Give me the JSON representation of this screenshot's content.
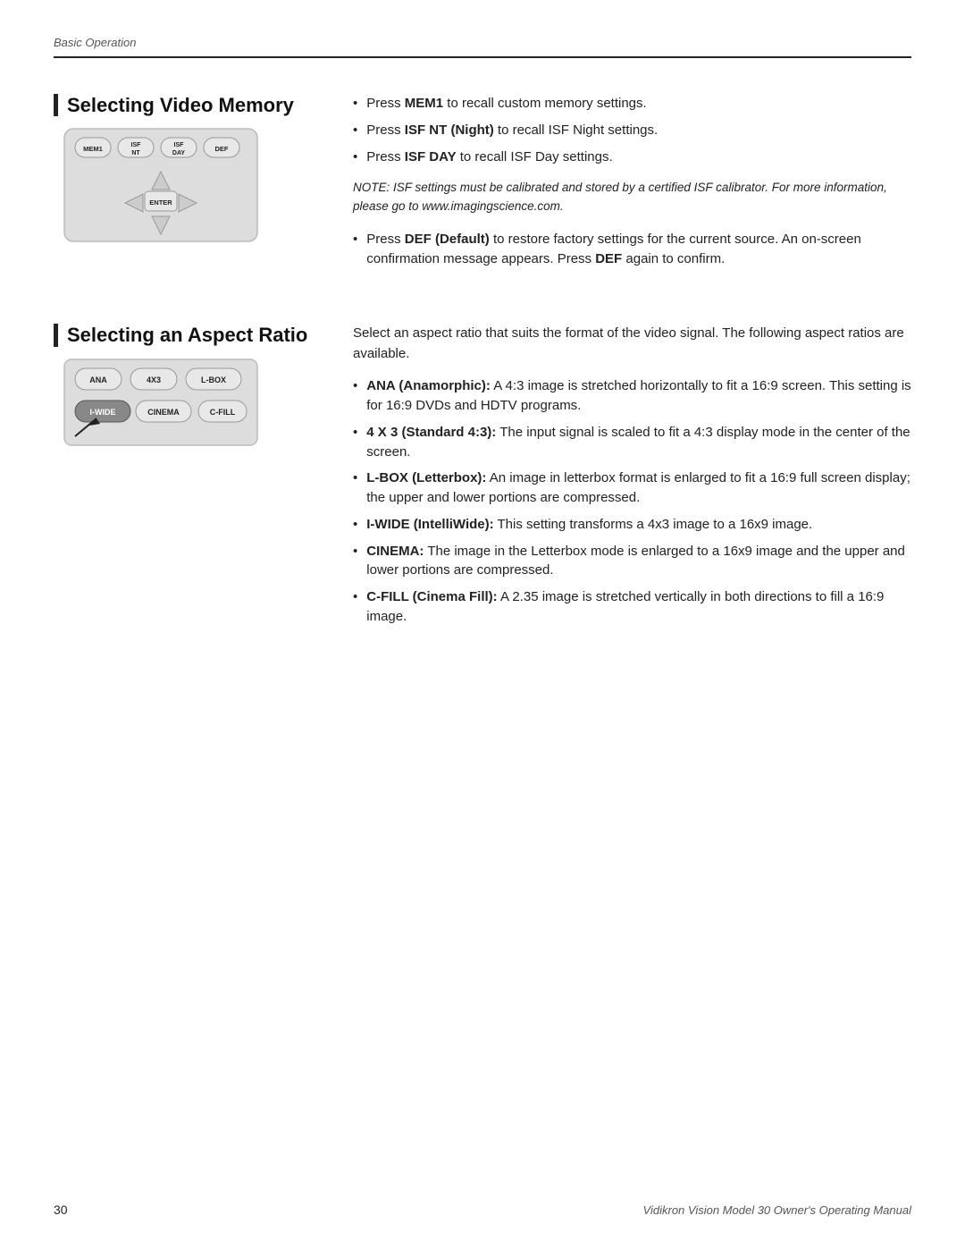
{
  "header": {
    "breadcrumb": "Basic Operation"
  },
  "section1": {
    "title": "Selecting Video Memory",
    "bullets": [
      {
        "text_before": "Press ",
        "bold": "MEM1",
        "text_after": " to recall custom memory settings."
      },
      {
        "text_before": "Press ",
        "bold": "ISF NT",
        "text_bold2": " (Night)",
        "text_after": " to recall ISF Night settings."
      },
      {
        "text_before": "Press ",
        "bold": "ISF DAY",
        "text_after": " to recall ISF Day settings."
      }
    ],
    "note": "NOTE: ISF settings must be calibrated and stored by a certified ISF calibrator. For more information, please go to www.imagingscience.com.",
    "bullet_extra": {
      "text_before": "Press ",
      "bold": "DEF (Default)",
      "text_after": " to restore factory settings for the current source. An on-screen confirmation message appears. Press ",
      "bold2": "DEF",
      "text_after2": " again to confirm."
    }
  },
  "section2": {
    "title": "Selecting an Aspect Ratio",
    "intro": "Select an aspect ratio that suits the format of the video signal. The following aspect ratios are available.",
    "bullets": [
      {
        "bold": "ANA (Anamorphic):",
        "text": " A 4:3 image is stretched horizontally to fit a 16:9 screen. This setting is for 16:9 DVDs and HDTV programs."
      },
      {
        "bold": "4 X 3 (Standard 4:3):",
        "text": " The input signal is scaled to fit a 4:3 display mode in the center of the screen."
      },
      {
        "bold": "L-BOX (Letterbox):",
        "text": " An image in letterbox format is enlarged to fit a 16:9 full screen display; the upper and lower portions are compressed."
      },
      {
        "bold": "I-WIDE (IntelliWide):",
        "text": " This setting transforms a 4x3 image to a 16x9 image."
      },
      {
        "bold": "CINEMA:",
        "text": " The image in the Letterbox mode is enlarged to a 16x9 image and the upper and lower portions are compressed."
      },
      {
        "bold": "C-FILL (Cinema Fill):",
        "text": " A 2.35 image is stretched vertically in both directions to fill a 16:9 image."
      }
    ]
  },
  "footer": {
    "page_number": "30",
    "title": "Vidikron Vision Model 30 Owner's Operating Manual"
  }
}
